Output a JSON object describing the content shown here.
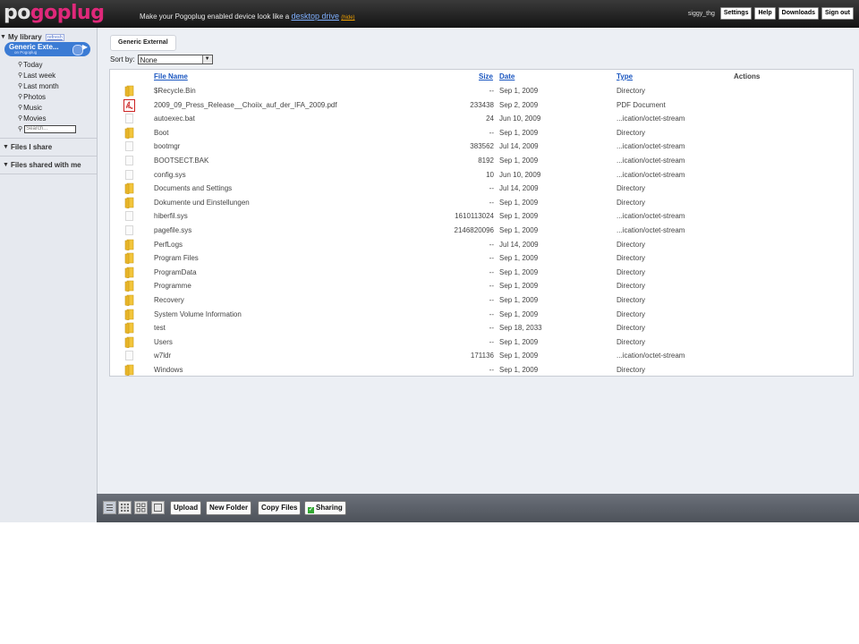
{
  "header": {
    "logo_part1": "p",
    "logo_part2": "o",
    "logo_part3": "goplug",
    "promo_text": "Make your Pogoplug enabled device look like a ",
    "promo_link": "desktop drive",
    "promo_hide": "(hide)",
    "username": "siggy_thg",
    "buttons": [
      "Settings",
      "Help",
      "Downloads",
      "Sign out"
    ]
  },
  "sidebar": {
    "library_title": "My library",
    "refresh": "refresh",
    "device_name": "Generic Exte...",
    "device_sub": "on Pogoplug",
    "filters": [
      "Today",
      "Last week",
      "Last month",
      "Photos",
      "Music",
      "Movies"
    ],
    "search_placeholder": "Search...",
    "files_i_share": "Files I share",
    "files_shared_with_me": "Files shared with me"
  },
  "main": {
    "tab_label": "Generic External",
    "sort_label": "Sort by:",
    "sort_value": "None",
    "columns": {
      "name": "File Name",
      "size": "Size",
      "date": "Date",
      "type": "Type",
      "actions": "Actions"
    },
    "files": [
      {
        "icon": "folder",
        "name": "$Recycle.Bin",
        "size": "--",
        "date": "Sep 1, 2009",
        "type": "Directory"
      },
      {
        "icon": "pdf",
        "name": "2009_09_Press_Release__Choiix_auf_der_IFA_2009.pdf",
        "size": "233438",
        "date": "Sep 2, 2009",
        "type": "PDF Document"
      },
      {
        "icon": "file",
        "name": "autoexec.bat",
        "size": "24",
        "date": "Jun 10, 2009",
        "type": "...ication/octet-stream"
      },
      {
        "icon": "folder",
        "name": "Boot",
        "size": "--",
        "date": "Sep 1, 2009",
        "type": "Directory"
      },
      {
        "icon": "file",
        "name": "bootmgr",
        "size": "383562",
        "date": "Jul 14, 2009",
        "type": "...ication/octet-stream"
      },
      {
        "icon": "file",
        "name": "BOOTSECT.BAK",
        "size": "8192",
        "date": "Sep 1, 2009",
        "type": "...ication/octet-stream"
      },
      {
        "icon": "file",
        "name": "config.sys",
        "size": "10",
        "date": "Jun 10, 2009",
        "type": "...ication/octet-stream"
      },
      {
        "icon": "folder",
        "name": "Documents and Settings",
        "size": "--",
        "date": "Jul 14, 2009",
        "type": "Directory"
      },
      {
        "icon": "folder",
        "name": "Dokumente und Einstellungen",
        "size": "--",
        "date": "Sep 1, 2009",
        "type": "Directory"
      },
      {
        "icon": "file",
        "name": "hiberfil.sys",
        "size": "1610113024",
        "date": "Sep 1, 2009",
        "type": "...ication/octet-stream"
      },
      {
        "icon": "file",
        "name": "pagefile.sys",
        "size": "2146820096",
        "date": "Sep 1, 2009",
        "type": "...ication/octet-stream"
      },
      {
        "icon": "folder",
        "name": "PerfLogs",
        "size": "--",
        "date": "Jul 14, 2009",
        "type": "Directory"
      },
      {
        "icon": "folder",
        "name": "Program Files",
        "size": "--",
        "date": "Sep 1, 2009",
        "type": "Directory"
      },
      {
        "icon": "folder",
        "name": "ProgramData",
        "size": "--",
        "date": "Sep 1, 2009",
        "type": "Directory"
      },
      {
        "icon": "folder",
        "name": "Programme",
        "size": "--",
        "date": "Sep 1, 2009",
        "type": "Directory"
      },
      {
        "icon": "folder",
        "name": "Recovery",
        "size": "--",
        "date": "Sep 1, 2009",
        "type": "Directory"
      },
      {
        "icon": "folder",
        "name": "System Volume Information",
        "size": "--",
        "date": "Sep 1, 2009",
        "type": "Directory"
      },
      {
        "icon": "folder",
        "name": "test",
        "size": "--",
        "date": "Sep 18, 2033",
        "type": "Directory"
      },
      {
        "icon": "folder",
        "name": "Users",
        "size": "--",
        "date": "Sep 1, 2009",
        "type": "Directory"
      },
      {
        "icon": "file",
        "name": "w7ldr",
        "size": "171136",
        "date": "Sep 1, 2009",
        "type": "...ication/octet-stream"
      },
      {
        "icon": "folder",
        "name": "Windows",
        "size": "--",
        "date": "Sep 1, 2009",
        "type": "Directory"
      }
    ]
  },
  "toolbar": {
    "view_icons": [
      "list-view-icon",
      "small-thumbs-view-icon",
      "large-thumbs-view-icon",
      "slideshow-view-icon"
    ],
    "upload": "Upload",
    "new_folder": "New Folder",
    "copy_files": "Copy Files",
    "sharing": "Sharing"
  },
  "colors": {
    "brand_pink": "#e0287a",
    "link_blue": "#1a56c0",
    "device_pill": "#3b7bd4",
    "folder_yellow": "#f3c53b",
    "pdf_red": "#cc2222"
  }
}
